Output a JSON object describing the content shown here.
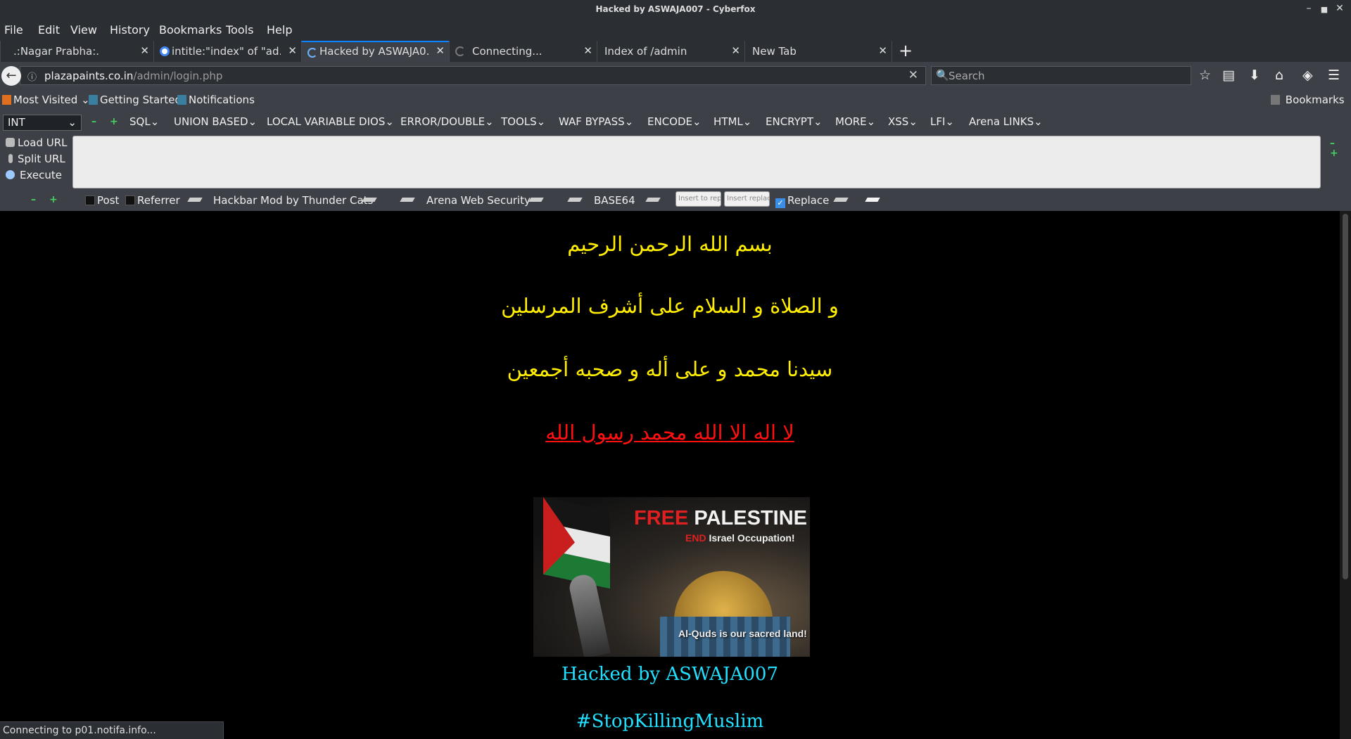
{
  "window": {
    "title": "Hacked by ASWAJA007 - Cyberfox",
    "minimize_glyph": "–",
    "maximize_glyph": "■",
    "close_glyph": "✕"
  },
  "menubar": [
    "File",
    "Edit",
    "View",
    "History",
    "Bookmarks",
    "Tools",
    "Help"
  ],
  "tabs": [
    {
      "label": ".:Nagar Prabha:.",
      "active": false,
      "icon": "none"
    },
    {
      "label": "intitle:\"index\" of \"ad...",
      "active": false,
      "icon": "google-icon"
    },
    {
      "label": "Hacked by ASWAJA0...",
      "active": true,
      "icon": "loading-icon"
    },
    {
      "label": "Connecting...",
      "active": false,
      "icon": "loading-icon"
    },
    {
      "label": "Index of /admin",
      "active": false,
      "icon": "none"
    },
    {
      "label": "New Tab",
      "active": false,
      "icon": "none"
    }
  ],
  "tab_close_glyph": "✕",
  "new_tab_glyph": "+",
  "navbar": {
    "back_glyph": "←",
    "info_glyph": "ⓘ",
    "url_host": "plazapaints.co.in",
    "url_path": "/admin/login.php",
    "clear_glyph": "✕",
    "search_placeholder": "Search",
    "search_glyph": "🔍",
    "icons": [
      "bookmark-star-icon",
      "reading-list-icon",
      "downloads-icon",
      "home-icon",
      "pocket-icon",
      "hamburger-menu-icon"
    ],
    "icon_glyphs": [
      "☆",
      "▤",
      "⬇",
      "⌂",
      "◈",
      "☰"
    ]
  },
  "bookmarks": {
    "items": [
      "Most Visited",
      "Getting Started",
      "Notifications"
    ],
    "right": "Bookmarks"
  },
  "hackbar": {
    "select_value": "INT",
    "green_minus": "–",
    "green_plus": "+",
    "menus": [
      "SQL",
      "UNION BASED",
      "LOCAL VARIABLE DIOS",
      "ERROR/DOUBLE",
      "TOOLS",
      "WAF BYPASS",
      "ENCODE",
      "HTML",
      "ENCRYPT",
      "MORE",
      "XSS",
      "LFI",
      "Arena LINKS"
    ],
    "actions": [
      "Load URL",
      "Split URL",
      "Execute"
    ],
    "textarea_value": "",
    "options": {
      "post": "Post",
      "referrer": "Referrer",
      "credit1": "Hackbar Mod by Thunder Cats",
      "credit2": "Arena Web Security",
      "base64": "BASE64",
      "insert1": "Insert to repl",
      "insert2": "Insert replaci",
      "replace": "Replace",
      "replace_checked": true
    }
  },
  "content": {
    "line1": "بسم الله الرحمن الرحيم",
    "line2": "و الصلاة و السلام على أشرف المرسلين",
    "line3": "سيدنا محمد و على أله و صحبه أجمعين",
    "line4": "لا اله الا الله محمد رسول الله",
    "poster": {
      "free": "FREE",
      "palestine": "PALESTINE",
      "end": "END",
      "occupation": "Israel Occupation!",
      "tagline": "Al-Quds is our sacred land!"
    },
    "hacked_by": "Hacked by ASWAJA007",
    "hashtag": "#StopKillingMuslim"
  },
  "status": "Connecting to p01.notifa.info...",
  "colors": {
    "arabic": "#ffee00",
    "arabic_red": "#ff1010",
    "cyan": "#22e0ff",
    "chrome_dark": "#2b2e33",
    "chrome_mid": "#3d4147",
    "accent": "#0a84ff"
  }
}
